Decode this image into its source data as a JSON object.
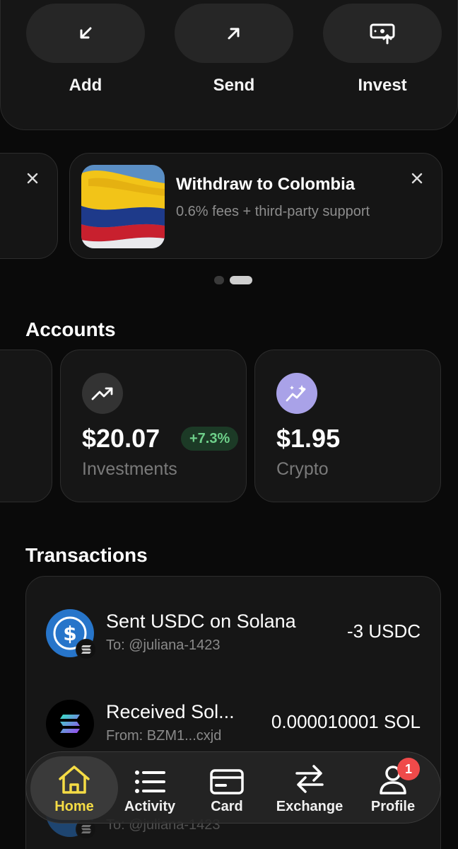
{
  "actions": [
    {
      "label": "Add",
      "icon": "arrow-down-left-icon"
    },
    {
      "label": "Send",
      "icon": "arrow-up-right-icon"
    },
    {
      "label": "Invest",
      "icon": "invest-icon"
    }
  ],
  "promo": {
    "title": "Withdraw to Colombia",
    "subtitle": "0.6% fees + third-party support",
    "image": "colombia-flag-image"
  },
  "accounts": {
    "title": "Accounts",
    "items": [
      {
        "amount": "$20.07",
        "label": "Investments",
        "change": "+7.3%",
        "icon": "trending-up-icon"
      },
      {
        "amount": "$1.95",
        "label": "Crypto",
        "icon": "sparkle-chart-icon"
      }
    ]
  },
  "transactions": {
    "title": "Transactions",
    "items": [
      {
        "title": "Sent USDC on Solana",
        "subtitle": "To: @juliana-1423",
        "amount": "-3 USDC",
        "icon": "usdc-icon"
      },
      {
        "title": "Received Sol...",
        "subtitle": "From: BZM1...cxjd",
        "amount": "0.000010001 SOL",
        "icon": "solana-icon"
      },
      {
        "title": "",
        "subtitle": "To: @juliana-1423",
        "amount": "",
        "icon": "usdc-icon"
      }
    ]
  },
  "nav": {
    "items": [
      {
        "label": "Home",
        "icon": "home-icon",
        "active": true
      },
      {
        "label": "Activity",
        "icon": "list-icon"
      },
      {
        "label": "Card",
        "icon": "card-icon"
      },
      {
        "label": "Exchange",
        "icon": "exchange-icon"
      },
      {
        "label": "Profile",
        "icon": "user-icon",
        "badge": "1"
      }
    ]
  },
  "colors": {
    "accent": "#f5dc45",
    "positive": "#6ed08a",
    "crypto": "#a9a2e8",
    "usdc": "#2775ca",
    "notification": "#ef4a4a"
  }
}
